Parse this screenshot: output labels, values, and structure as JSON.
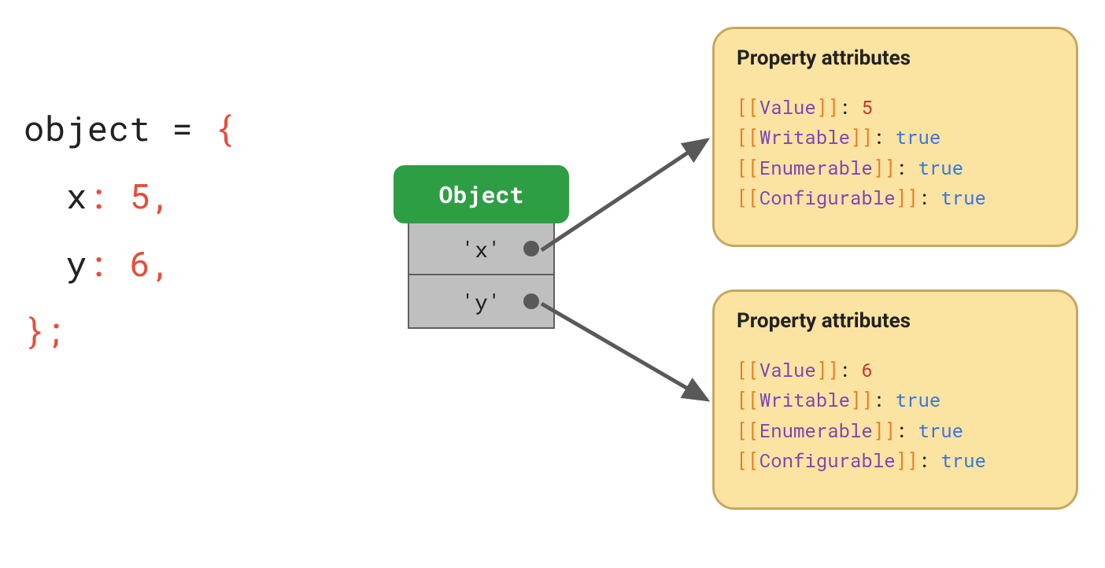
{
  "code": {
    "line1_object": "object",
    "line1_eq": " = ",
    "line1_brace": "{",
    "indent": "  ",
    "prop_x_name": "x",
    "punct_colon": ": ",
    "prop_x_val": "5",
    "comma": ",",
    "prop_y_name": "y",
    "prop_y_val": "6",
    "close": "};"
  },
  "object_box": {
    "header": "Object",
    "prop_x": "'x'",
    "prop_y": "'y'"
  },
  "attrs": {
    "title": "Property attributes",
    "bracket_open": "[[",
    "bracket_close": "]]",
    "colon_sp": ": ",
    "names": {
      "value": "Value",
      "writable": "Writable",
      "enumerable": "Enumerable",
      "configurable": "Configurable"
    },
    "x": {
      "value": "5",
      "writable": "true",
      "enumerable": "true",
      "configurable": "true"
    },
    "y": {
      "value": "6",
      "writable": "true",
      "enumerable": "true",
      "configurable": "true"
    }
  }
}
